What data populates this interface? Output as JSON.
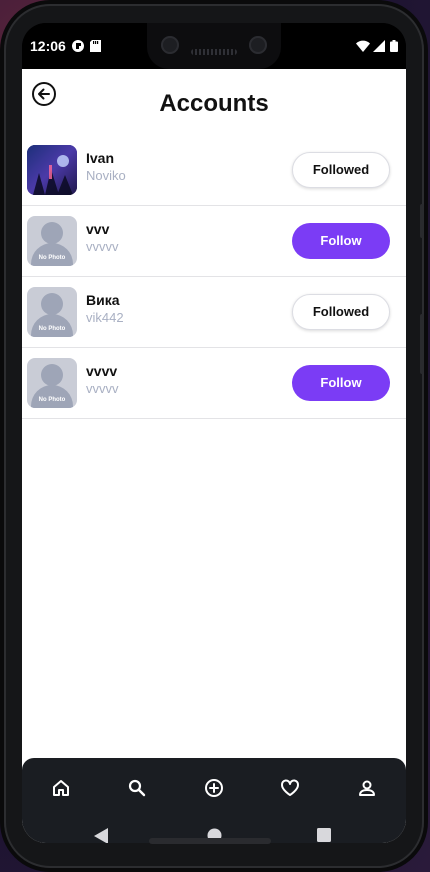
{
  "status_bar": {
    "time": "12:06"
  },
  "header": {
    "title": "Accounts"
  },
  "accounts": [
    {
      "name": "Ivan",
      "username": "Noviko",
      "button": "Followed",
      "state": "followed",
      "avatar": "photo"
    },
    {
      "name": "vvv",
      "username": "vvvvv",
      "button": "Follow",
      "state": "follow",
      "avatar": "placeholder"
    },
    {
      "name": "Вика",
      "username": "vik442",
      "button": "Followed",
      "state": "followed",
      "avatar": "placeholder"
    },
    {
      "name": "vvvv",
      "username": "vvvvv",
      "button": "Follow",
      "state": "follow",
      "avatar": "placeholder"
    }
  ],
  "placeholder_text": "No Photo",
  "bottom_nav": [
    "home-icon",
    "search-icon",
    "add-post-icon",
    "heart-icon",
    "profile-icon"
  ],
  "system_nav": [
    "back-triangle-icon",
    "home-circle-icon",
    "recents-square-icon"
  ],
  "colors": {
    "accent": "#7b3cf5",
    "nav_background": "#1a1d22",
    "username": "#a9b0c3"
  }
}
